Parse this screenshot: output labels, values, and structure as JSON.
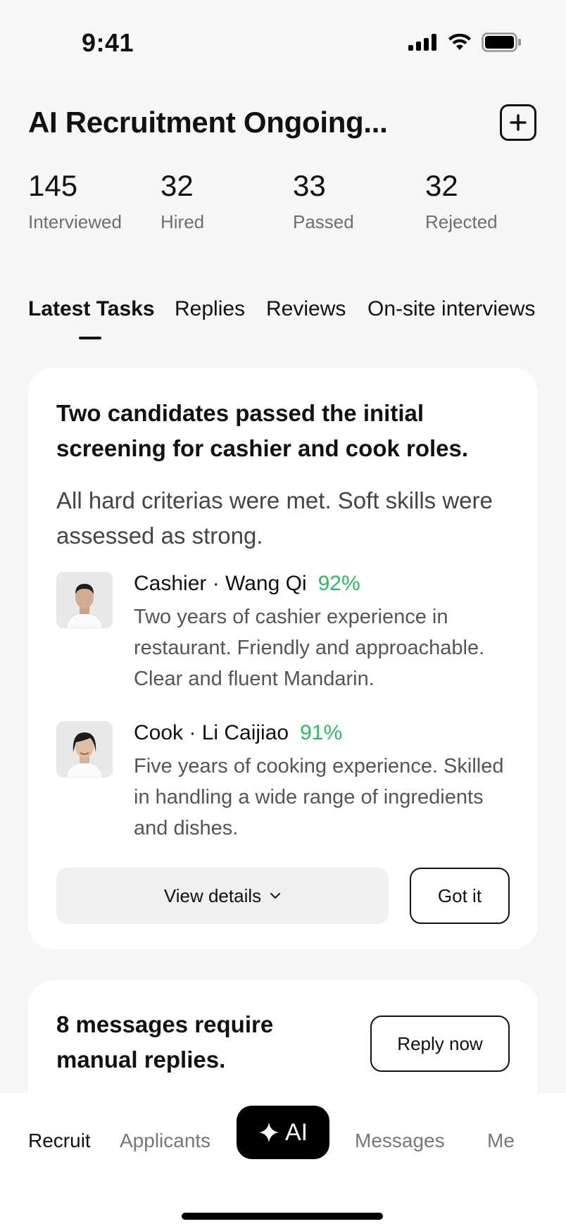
{
  "status_bar": {
    "time": "9:41"
  },
  "header": {
    "title": "AI Recruitment Ongoing..."
  },
  "stats": [
    {
      "value": "145",
      "label": "Interviewed"
    },
    {
      "value": "32",
      "label": "Hired"
    },
    {
      "value": "33",
      "label": "Passed"
    },
    {
      "value": "32",
      "label": "Rejected"
    }
  ],
  "tabs": [
    {
      "label": "Latest Tasks",
      "active": true
    },
    {
      "label": "Replies",
      "active": false
    },
    {
      "label": "Reviews",
      "active": false
    },
    {
      "label": "On-site interviews",
      "active": false
    }
  ],
  "task_card": {
    "heading": "Two candidates passed the initial screening for cashier and cook roles.",
    "subtext": "All hard criterias were met. Soft skills were assessed as strong.",
    "candidates": [
      {
        "title": "Cashier · Wang Qi",
        "score": "92%",
        "description": "Two years of cashier experience in restaurant. Friendly and approachable. Clear and fluent Mandarin."
      },
      {
        "title": "Cook · Li Caijiao",
        "score": "91%",
        "description": "Five years of cooking experience. Skilled in handling a wide range of ingredients and dishes."
      }
    ],
    "view_details_label": "View details",
    "got_it_label": "Got it"
  },
  "messages_card": {
    "text": "8 messages require manual replies.",
    "reply_label": "Reply now"
  },
  "bottom_nav": {
    "recruit": "Recruit",
    "applicants": "Applicants",
    "ai": "AI",
    "messages": "Messages",
    "me": "Me"
  },
  "colors": {
    "score_green": "#2fb866",
    "accent_black": "#000000"
  }
}
